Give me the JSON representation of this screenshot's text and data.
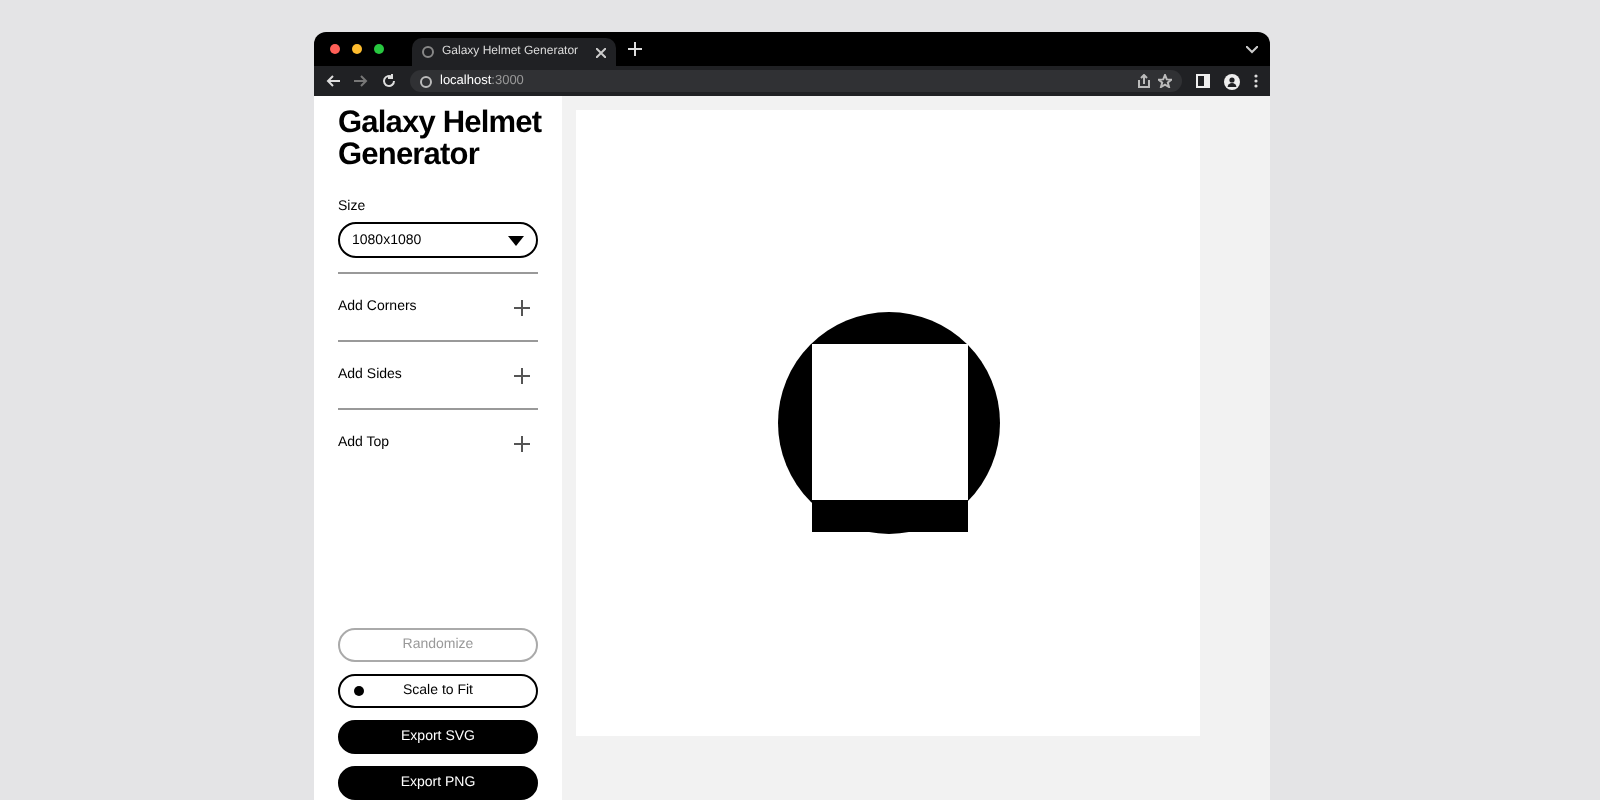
{
  "browser": {
    "tab_title": "Galaxy Helmet Generator",
    "url_host": "localhost",
    "url_port": ":3000"
  },
  "sidebar": {
    "title": "Galaxy Helmet Generator",
    "size_label": "Size",
    "size_value": "1080x1080",
    "sections": [
      {
        "label": "Add Corners",
        "expanded": false
      },
      {
        "label": "Add Sides",
        "expanded": false
      },
      {
        "label": "Add Top",
        "expanded": false
      }
    ],
    "buttons": [
      {
        "label": "Randomize",
        "kind": "outline",
        "disabled": true
      },
      {
        "label": "Scale to Fit",
        "kind": "toggle",
        "on": true
      },
      {
        "label": "Export SVG",
        "kind": "solid"
      },
      {
        "label": "Export PNG",
        "kind": "solid"
      }
    ]
  }
}
